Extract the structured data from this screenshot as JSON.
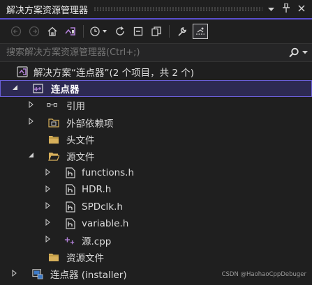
{
  "window": {
    "title": "解决方案资源管理器"
  },
  "search": {
    "placeholder": "搜索解决方案资源管理器(Ctrl+;)"
  },
  "tree": {
    "solution": "解决方案“连点器”(2 个项目，共 2 个)",
    "project": "连点器",
    "references": "引用",
    "external_deps": "外部依赖项",
    "header_files": "头文件",
    "source_files": "源文件",
    "files": [
      "functions.h",
      "HDR.h",
      "SPDclk.h",
      "variable.h",
      "源.cpp"
    ],
    "resource_files": "资源文件",
    "installer": "连点器  (installer)"
  },
  "watermark": "CSDN @HaohaoCppDebuger",
  "colors": {
    "accent": "#5a4fcf",
    "selected_bg": "#2d2a52",
    "folder": "#d7b05b",
    "cpp_purple": "#b180d7"
  }
}
